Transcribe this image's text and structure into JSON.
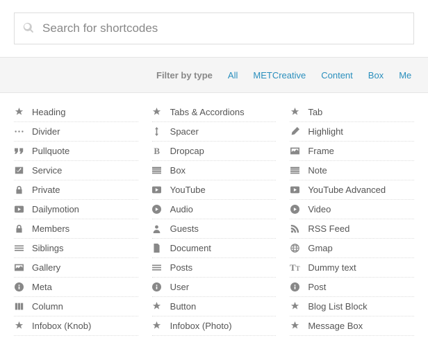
{
  "search": {
    "placeholder": "Search for shortcodes"
  },
  "filter": {
    "label": "Filter by type",
    "tabs": [
      "All",
      "METCreative",
      "Content",
      "Box",
      "Me"
    ]
  },
  "items": [
    {
      "icon": "star",
      "label": "Heading"
    },
    {
      "icon": "star",
      "label": "Tabs & Accordions"
    },
    {
      "icon": "star",
      "label": "Tab"
    },
    {
      "icon": "dots",
      "label": "Divider"
    },
    {
      "icon": "arrows-v",
      "label": "Spacer"
    },
    {
      "icon": "pencil",
      "label": "Highlight"
    },
    {
      "icon": "quote",
      "label": "Pullquote"
    },
    {
      "icon": "letter-B",
      "label": "Dropcap"
    },
    {
      "icon": "image",
      "label": "Frame"
    },
    {
      "icon": "check",
      "label": "Service"
    },
    {
      "icon": "list",
      "label": "Box"
    },
    {
      "icon": "list",
      "label": "Note"
    },
    {
      "icon": "lock",
      "label": "Private"
    },
    {
      "icon": "play",
      "label": "YouTube"
    },
    {
      "icon": "play",
      "label": "YouTube Advanced"
    },
    {
      "icon": "play",
      "label": "Dailymotion"
    },
    {
      "icon": "play-circle",
      "label": "Audio"
    },
    {
      "icon": "play-circle",
      "label": "Video"
    },
    {
      "icon": "lock",
      "label": "Members"
    },
    {
      "icon": "user",
      "label": "Guests"
    },
    {
      "icon": "rss",
      "label": "RSS Feed"
    },
    {
      "icon": "lines",
      "label": "Siblings"
    },
    {
      "icon": "doc",
      "label": "Document"
    },
    {
      "icon": "globe",
      "label": "Gmap"
    },
    {
      "icon": "image",
      "label": "Gallery"
    },
    {
      "icon": "lines",
      "label": "Posts"
    },
    {
      "icon": "letter-T",
      "label": "Dummy text"
    },
    {
      "icon": "info",
      "label": "Meta"
    },
    {
      "icon": "info",
      "label": "User"
    },
    {
      "icon": "info",
      "label": "Post"
    },
    {
      "icon": "col",
      "label": "Column"
    },
    {
      "icon": "star",
      "label": "Button"
    },
    {
      "icon": "star",
      "label": "Blog List Block"
    },
    {
      "icon": "star",
      "label": "Infobox (Knob)"
    },
    {
      "icon": "star",
      "label": "Infobox (Photo)"
    },
    {
      "icon": "star",
      "label": "Message Box"
    }
  ]
}
